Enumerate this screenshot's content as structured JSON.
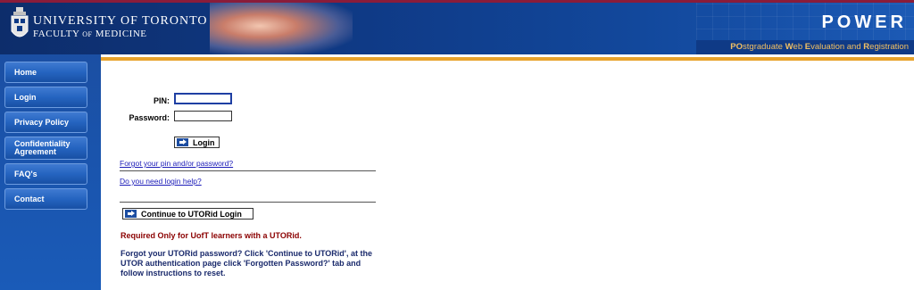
{
  "header": {
    "university": "UNIVERSITY OF TORONTO",
    "faculty_main": "FACULTY",
    "faculty_of": "OF",
    "faculty_end": "MEDICINE",
    "app_name": "POWER",
    "tagline_parts": [
      {
        "t": "PO",
        "b": true
      },
      {
        "t": "stgraduate ",
        "b": false
      },
      {
        "t": "W",
        "b": true
      },
      {
        "t": "eb ",
        "b": false
      },
      {
        "t": "E",
        "b": true
      },
      {
        "t": "valuation and ",
        "b": false
      },
      {
        "t": "R",
        "b": true
      },
      {
        "t": "egistration",
        "b": false
      }
    ]
  },
  "sidebar": {
    "items": [
      {
        "label": "Home"
      },
      {
        "label": "Login"
      },
      {
        "label": "Privacy Policy"
      },
      {
        "label": "Confidentiality Agreement"
      },
      {
        "label": "FAQ's"
      },
      {
        "label": "Contact"
      }
    ]
  },
  "login": {
    "pin_label": "PIN:",
    "pin_value": "",
    "password_label": "Password:",
    "password_value": "",
    "login_button": "Login",
    "forgot_link": "Forgot your pin and/or password?",
    "help_link": "Do you need login help?",
    "utorid_button": "Continue to UTORid Login",
    "required_note": "Required Only for UofT learners with a UTORid.",
    "utorid_help": "Forgot your UTORid password? Click 'Continue to UTORid', at the UTOR authentication page click 'Forgotten Password?' tab and follow instructions to reset."
  },
  "colors": {
    "header_blue": "#0f3a86",
    "accent_gold": "#e8a32c",
    "required_red": "#8b0000",
    "link_blue": "#1b1bb8"
  }
}
